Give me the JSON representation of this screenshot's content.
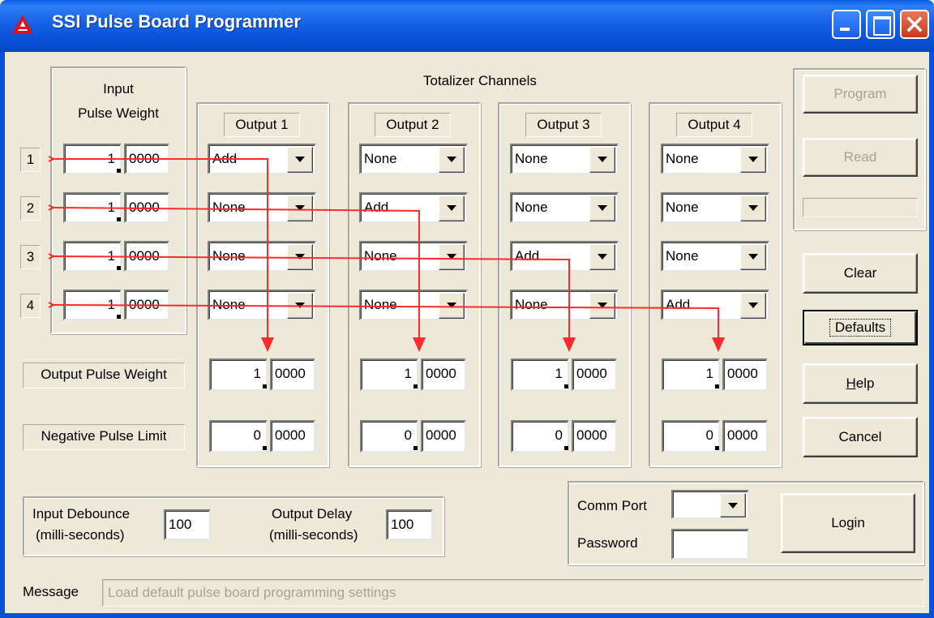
{
  "window": {
    "title": "SSI Pulse Board Programmer",
    "icon": "ssi-logo-icon"
  },
  "input_group": {
    "label": "Input\nPulse Weight",
    "label_line1": "Input",
    "label_line2": "Pulse Weight"
  },
  "inputs": [
    {
      "num": "1",
      "int": "1",
      "frac": "0000"
    },
    {
      "num": "2",
      "int": "1",
      "frac": "0000"
    },
    {
      "num": "3",
      "int": "1",
      "frac": "0000"
    },
    {
      "num": "4",
      "int": "1",
      "frac": "0000"
    }
  ],
  "totalizer": {
    "label": "Totalizer Channels"
  },
  "outputs": [
    {
      "label": "Output 1",
      "modes": [
        "Add",
        "None",
        "None",
        "None"
      ],
      "opw_int": "1",
      "opw_frac": "0000",
      "npl_int": "0",
      "npl_frac": "0000"
    },
    {
      "label": "Output 2",
      "modes": [
        "None",
        "Add",
        "None",
        "None"
      ],
      "opw_int": "1",
      "opw_frac": "0000",
      "npl_int": "0",
      "npl_frac": "0000"
    },
    {
      "label": "Output 3",
      "modes": [
        "None",
        "None",
        "Add",
        "None"
      ],
      "opw_int": "1",
      "opw_frac": "0000",
      "npl_int": "0",
      "npl_frac": "0000"
    },
    {
      "label": "Output 4",
      "modes": [
        "None",
        "None",
        "None",
        "Add"
      ],
      "opw_int": "1",
      "opw_frac": "0000",
      "npl_int": "0",
      "npl_frac": "0000"
    }
  ],
  "row_labels": {
    "output_pulse_weight": "Output Pulse Weight",
    "negative_pulse_limit": "Negative Pulse Limit"
  },
  "buttons": {
    "program": "Program",
    "read": "Read",
    "clear": "Clear",
    "defaults": "Defaults",
    "help": "Help",
    "cancel": "Cancel",
    "login": "Login"
  },
  "timing": {
    "input_debounce_label1": "Input Debounce",
    "input_debounce_label2": "(milli-seconds)",
    "input_debounce_value": "100",
    "output_delay_label1": "Output Delay",
    "output_delay_label2": "(milli-seconds)",
    "output_delay_value": "100"
  },
  "comm": {
    "port_label": "Comm Port",
    "port_value": "",
    "password_label": "Password",
    "password_value": ""
  },
  "message": {
    "label": "Message",
    "text": "Load default pulse board programming settings"
  },
  "colors": {
    "wire": "#FF2A2A",
    "titlebar": "#0A5BE0"
  }
}
